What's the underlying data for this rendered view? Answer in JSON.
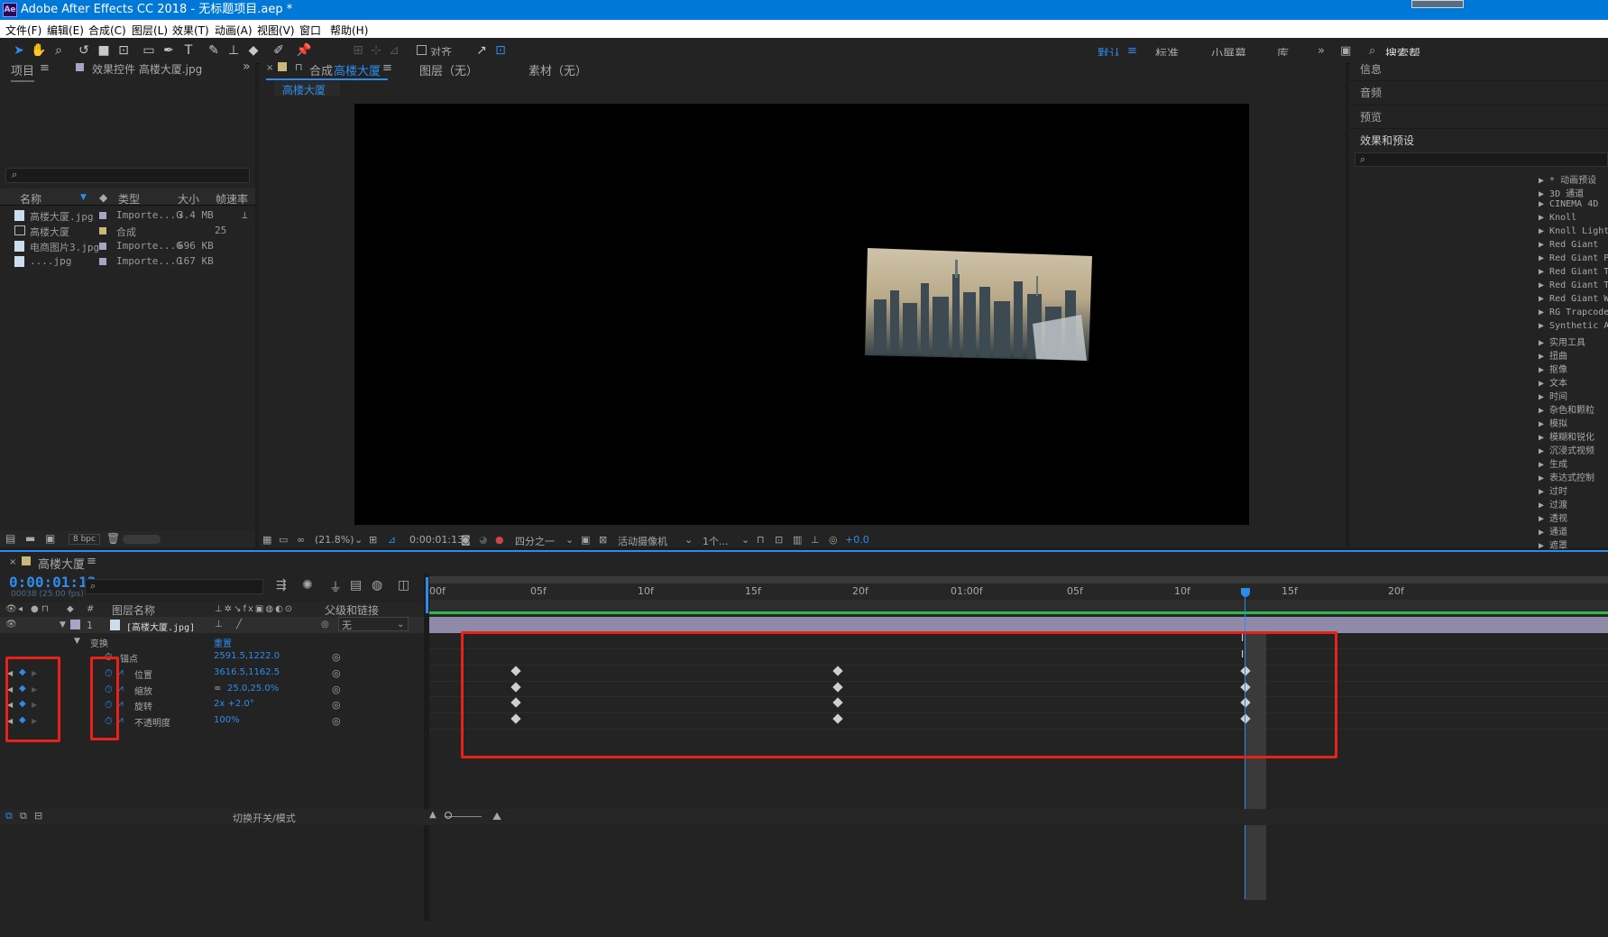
{
  "titlebar": {
    "logo": "Ae",
    "title": "Adobe After Effects CC 2018 - 无标题项目.aep *"
  },
  "menu": [
    "文件(F)",
    "编辑(E)",
    "合成(C)",
    "图层(L)",
    "效果(T)",
    "动画(A)",
    "视图(V)",
    "窗口",
    "帮助(H)"
  ],
  "toolbar": {
    "snap_label": "对齐",
    "workspaces": [
      "默认",
      "标准",
      "小屏幕",
      "库"
    ],
    "search_help": "搜索帮"
  },
  "project_panel": {
    "tab_project": "项目",
    "tab_effects": "效果控件 高楼大厦.jpg",
    "columns": {
      "name": "名称",
      "type": "类型",
      "size": "大小",
      "fps": "帧速率"
    },
    "items": [
      {
        "name": "高楼大厦.jpg",
        "type": "Importe...G",
        "size": "3.4 MB",
        "fps": ""
      },
      {
        "name": "高楼大厦",
        "type": "合成",
        "size": "",
        "fps": "25"
      },
      {
        "name": "电商图片3.jpg",
        "type": "Importe...G",
        "size": "696 KB",
        "fps": ""
      },
      {
        "name": "....jpg",
        "type": "Importe...G",
        "size": "167 KB",
        "fps": ""
      }
    ],
    "bpc": "8 bpc"
  },
  "viewer": {
    "tab_comp_prefix": "合成",
    "tab_comp_name": "高楼大厦",
    "tab_layer": "图层（无）",
    "tab_footage": "素材（无）",
    "breadcrumb": "高楼大厦",
    "zoom": "(21.8%)",
    "timecode": "0:00:01:13",
    "resolution": "四分之一",
    "camera": "活动摄像机",
    "views": "1个...",
    "exposure": "+0.0"
  },
  "right_panel": {
    "tabs": [
      "信息",
      "音频",
      "预览",
      "效果和预设"
    ],
    "effects": [
      "* 动画预设",
      "3D 通道",
      "CINEMA 4D",
      "Knoll",
      "Knoll Light",
      "Red Giant",
      "Red Giant P",
      "Red Giant T",
      "Red Giant T",
      "Red Giant W",
      "RG Trapcode",
      "Synthetic A",
      "实用工具",
      "扭曲",
      "抠像",
      "文本",
      "时间",
      "杂色和颗粒",
      "模拟",
      "模糊和锐化",
      "沉浸式视频",
      "生成",
      "表达式控制",
      "过时",
      "过渡",
      "透视",
      "通道",
      "遮罩"
    ]
  },
  "timeline": {
    "tab": "高楼大厦",
    "timecode": "0:00:01:13",
    "frame_info": "00038 (25.00 fps)",
    "col_layer_name": "图层名称",
    "col_parent": "父级和链接",
    "layer": {
      "num": "1",
      "name": "[高楼大厦.jpg]",
      "parent": "无"
    },
    "transform_label": "变换",
    "reset_label": "重置",
    "props": [
      {
        "name": "锚点",
        "value": "2591.5,1222.0"
      },
      {
        "name": "位置",
        "value": "3616.5,1162.5"
      },
      {
        "name": "缩放",
        "value": "25.0,25.0%"
      },
      {
        "name": "旋转",
        "value": "2x +2.0°"
      },
      {
        "name": "不透明度",
        "value": "100%"
      }
    ],
    "ruler": [
      "00f",
      "05f",
      "10f",
      "15f",
      "20f",
      "01:00f",
      "05f",
      "10f",
      "15f",
      "20f"
    ],
    "toggle_label": "切换开关/模式"
  },
  "colors": {
    "accent": "#2d8ceb",
    "highlight": "#e8211b",
    "titlebar": "#0078d7"
  }
}
